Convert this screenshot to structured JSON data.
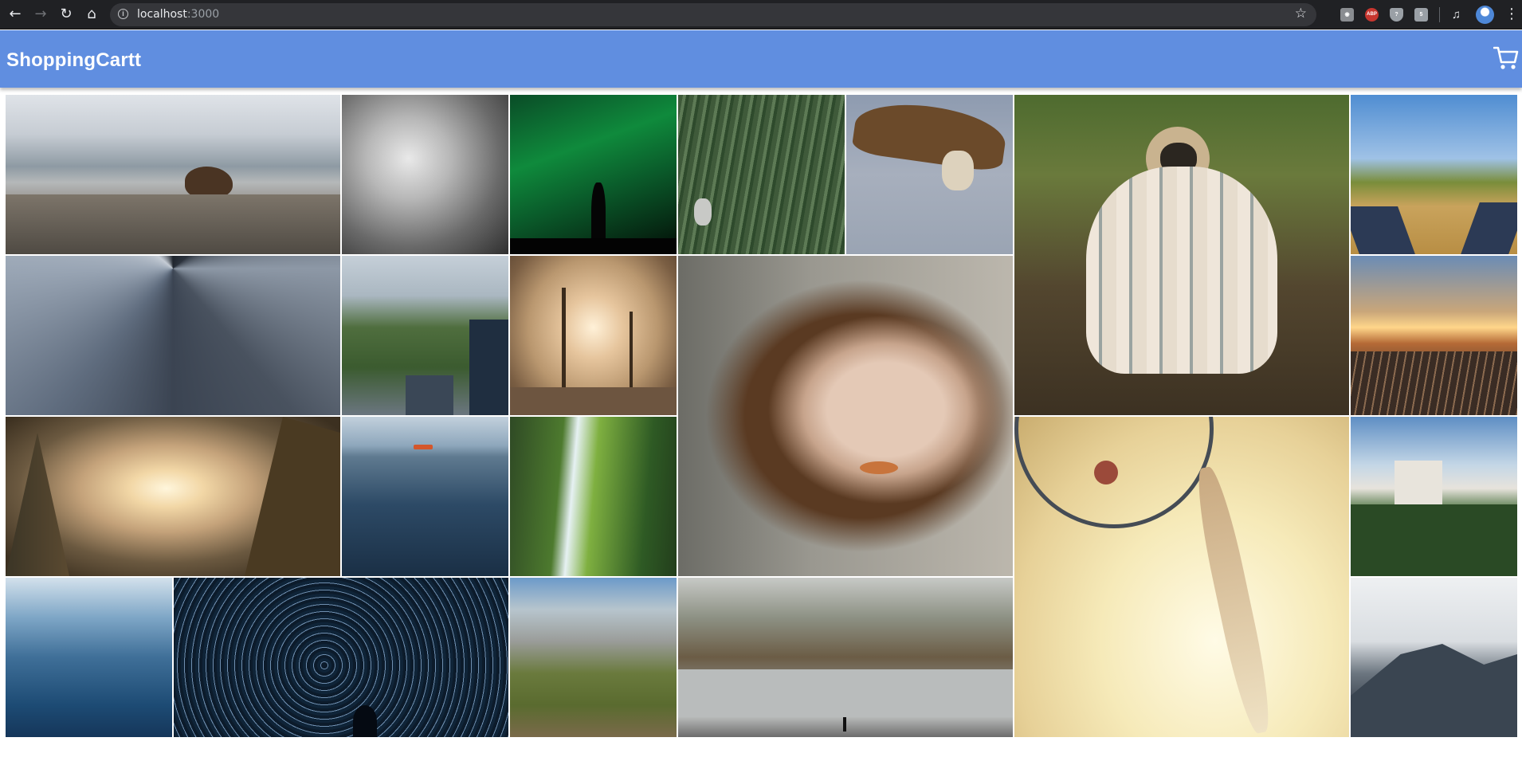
{
  "browser": {
    "url_host": "localhost",
    "url_port": ":3000",
    "icons": {
      "back": "back-arrow-icon",
      "forward": "forward-arrow-icon",
      "reload": "reload-icon",
      "home": "home-icon",
      "info": "info-icon",
      "star": "star-icon",
      "menu": "kebab-menu-icon"
    },
    "extensions": [
      "camera-icon",
      "adblock-plus-icon",
      "shield-icon",
      "html5-icon",
      "media-control-icon"
    ]
  },
  "app": {
    "title": "ShoppingCartt",
    "header_color": "#608ee0",
    "cart_icon": "shopping-cart-icon"
  },
  "gallery": {
    "photos": [
      {
        "id": "bear",
        "subject": "bear on rocky hillside"
      },
      {
        "id": "fog",
        "subject": "misty forest in black and white"
      },
      {
        "id": "aurora",
        "subject": "green aurora over tree silhouette"
      },
      {
        "id": "forest",
        "subject": "mountain biker in pine forest"
      },
      {
        "id": "eagle",
        "subject": "eagle with spread wings"
      },
      {
        "id": "pug",
        "subject": "pug wrapped in blanket"
      },
      {
        "id": "field",
        "subject": "feet in sneakers on wheat field"
      },
      {
        "id": "skyscraper",
        "subject": "skyscraper looking up"
      },
      {
        "id": "city",
        "subject": "city skyline with park"
      },
      {
        "id": "desert",
        "subject": "dead trees at sunset"
      },
      {
        "id": "woman",
        "subject": "portrait of woman with curly hair"
      },
      {
        "id": "train",
        "subject": "train tracks at sunset"
      },
      {
        "id": "mountain-sun",
        "subject": "mountain valley at sunrise"
      },
      {
        "id": "lake",
        "subject": "lake with boat and mountains"
      },
      {
        "id": "waterfall",
        "subject": "waterfall in green canyon"
      },
      {
        "id": "dreamcatcher",
        "subject": "dreamcatcher with feathers"
      },
      {
        "id": "castle",
        "subject": "castle on forested hill"
      },
      {
        "id": "wave",
        "subject": "ocean wave"
      },
      {
        "id": "startrails",
        "subject": "star trails with silhouette"
      },
      {
        "id": "yosemite",
        "subject": "granite cliffs and forest"
      },
      {
        "id": "river",
        "subject": "rocky river in misty valley"
      },
      {
        "id": "foggy-mountain",
        "subject": "foggy mountain peaks"
      }
    ]
  }
}
